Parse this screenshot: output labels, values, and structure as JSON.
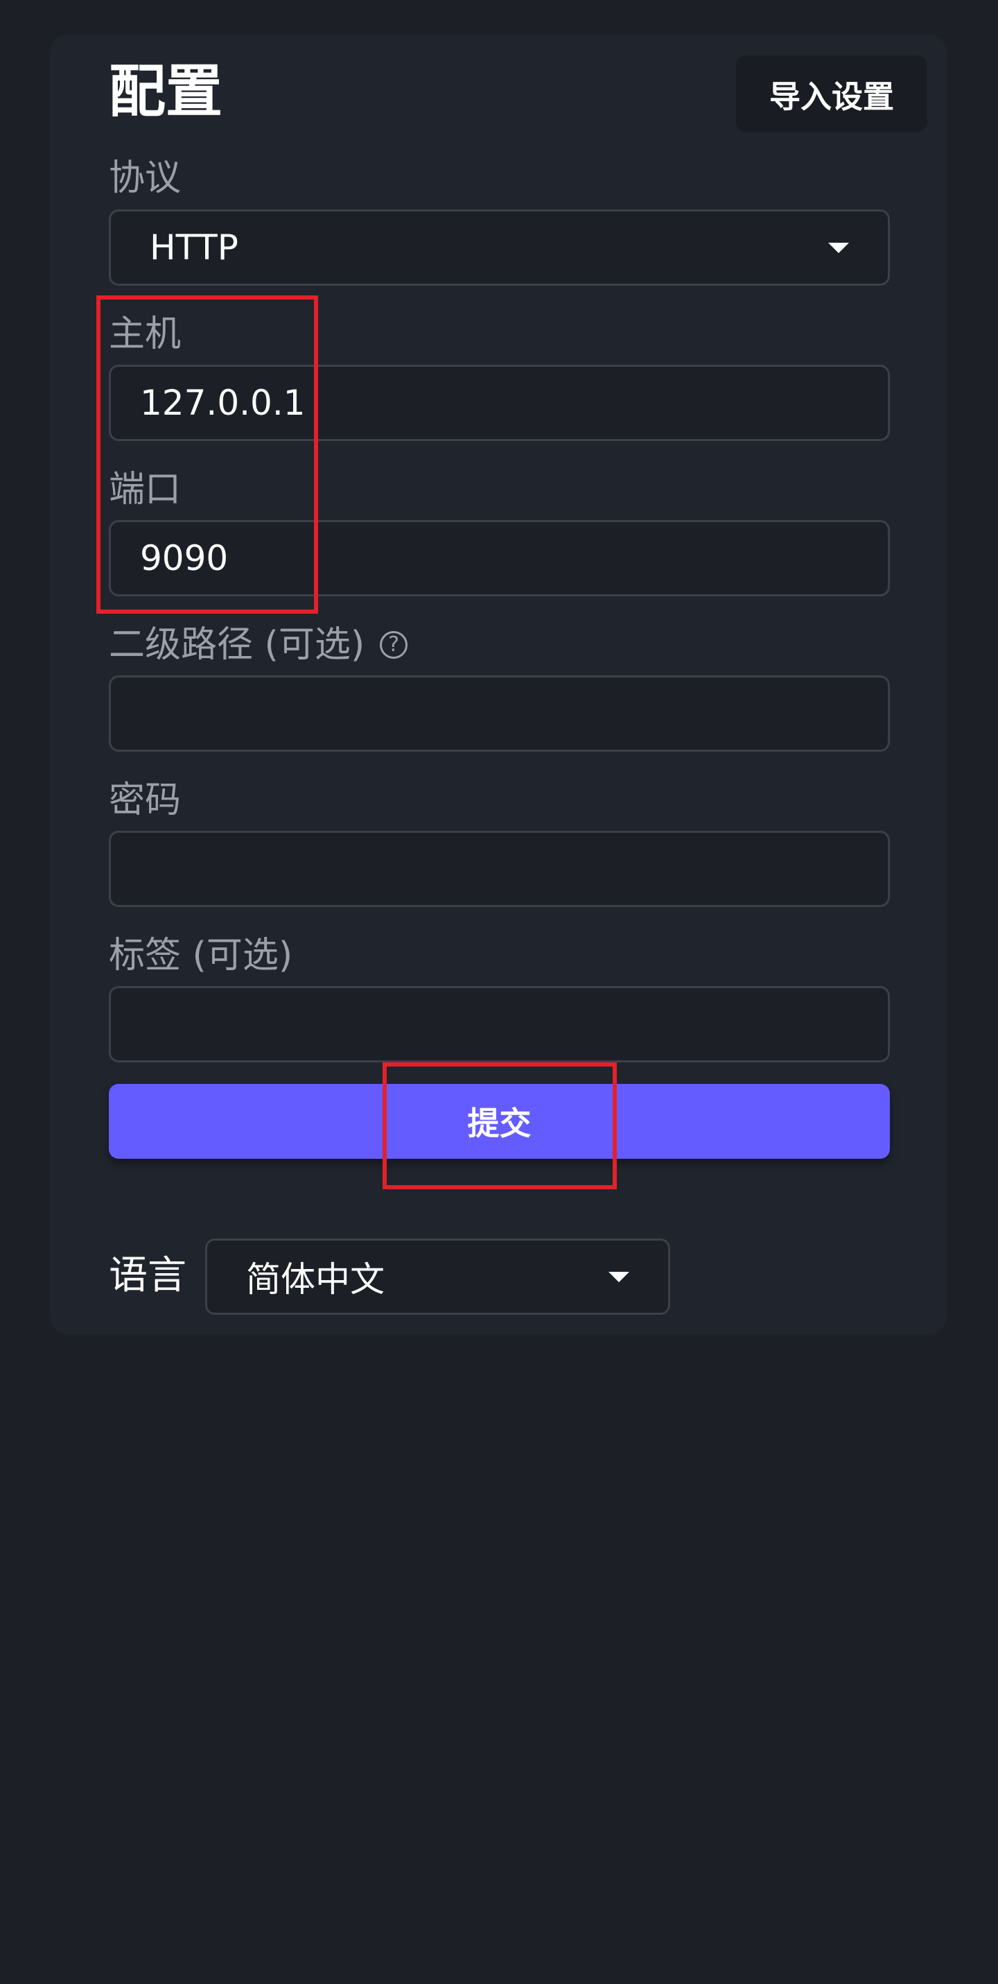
{
  "header": {
    "title": "配置",
    "import_label": "导入设置"
  },
  "form": {
    "protocol": {
      "label": "协议",
      "value": "HTTP"
    },
    "host": {
      "label": "主机",
      "value": "127.0.0.1"
    },
    "port": {
      "label": "端口",
      "value": "9090"
    },
    "subpath": {
      "label": "二级路径 (可选)",
      "value": "",
      "help_icon": "question-circle-icon"
    },
    "password": {
      "label": "密码",
      "value": ""
    },
    "tag": {
      "label": "标签 (可选)",
      "value": ""
    },
    "submit_label": "提交"
  },
  "language": {
    "label": "语言",
    "value": "简体中文"
  },
  "colors": {
    "page_background": "#1c1f26",
    "card_background": "#20242c",
    "accent": "#645cff",
    "highlight_box": "#e5202a"
  }
}
